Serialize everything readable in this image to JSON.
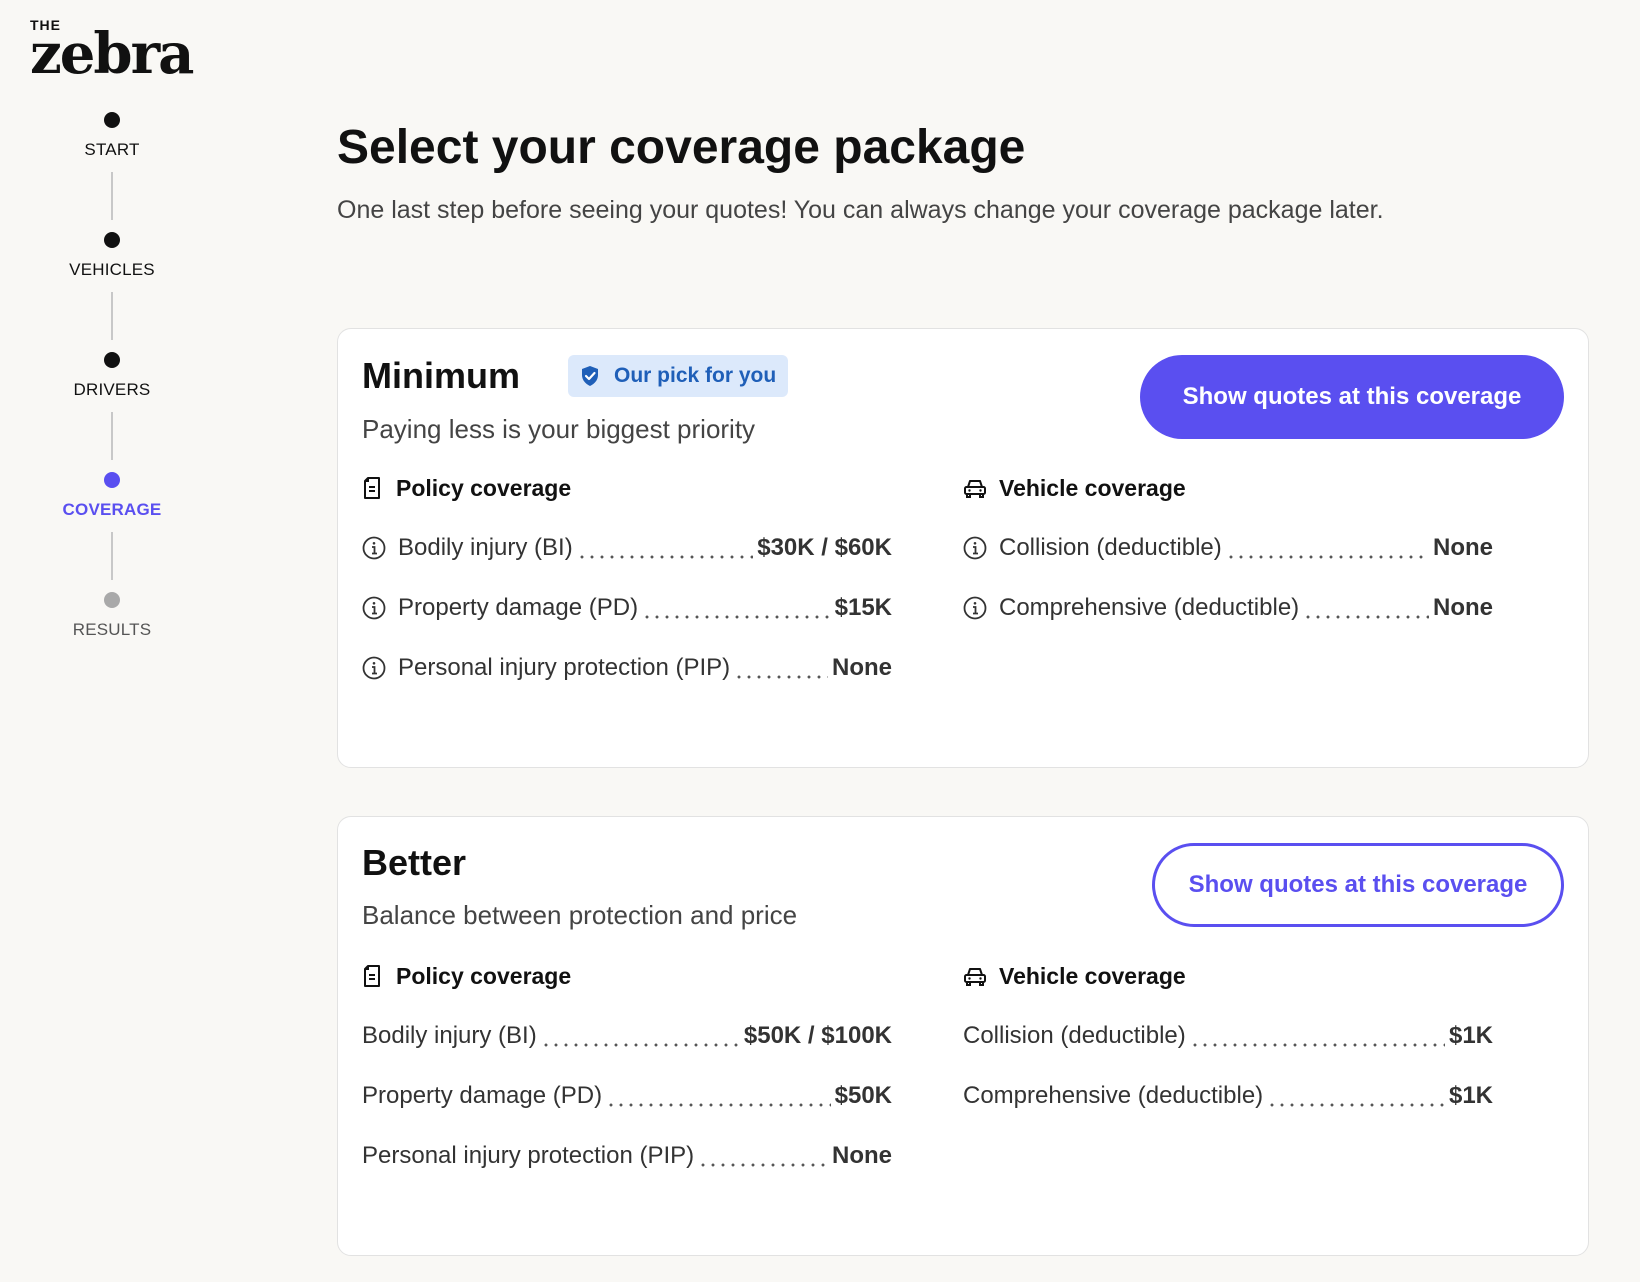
{
  "logo": {
    "small": "THE",
    "word": "zebra"
  },
  "stepper": [
    {
      "label": "START",
      "state": "done"
    },
    {
      "label": "VEHICLES",
      "state": "done"
    },
    {
      "label": "DRIVERS",
      "state": "done"
    },
    {
      "label": "COVERAGE",
      "state": "active"
    },
    {
      "label": "RESULTS",
      "state": "pending"
    }
  ],
  "header": {
    "title": "Select your coverage package",
    "subtitle": "One last step before seeing your quotes! You can always change your coverage package later."
  },
  "colors": {
    "accent": "#5a4ff0",
    "badge_bg": "#dce9fb",
    "badge_text": "#1f5fb8"
  },
  "packages": [
    {
      "title": "Minimum",
      "badge": "Our pick for you",
      "description": "Paying less is your biggest priority",
      "button": "Show quotes at this coverage",
      "policy_heading": "Policy coverage",
      "vehicle_heading": "Vehicle coverage",
      "policy": [
        {
          "label": "Bodily injury (BI)",
          "value": "$30K / $60K"
        },
        {
          "label": "Property damage (PD)",
          "value": "$15K"
        },
        {
          "label": "Personal injury protection (PIP)",
          "value": "None"
        }
      ],
      "vehicle": [
        {
          "label": "Collision (deductible)",
          "value": "None"
        },
        {
          "label": "Comprehensive (deductible)",
          "value": "None"
        }
      ]
    },
    {
      "title": "Better",
      "description": "Balance between protection and price",
      "button": "Show quotes at this coverage",
      "policy_heading": "Policy coverage",
      "vehicle_heading": "Vehicle coverage",
      "policy": [
        {
          "label": "Bodily injury (BI)",
          "value": "$50K / $100K"
        },
        {
          "label": "Property damage (PD)",
          "value": "$50K"
        },
        {
          "label": "Personal injury protection (PIP)",
          "value": "None"
        }
      ],
      "vehicle": [
        {
          "label": "Collision (deductible)",
          "value": "$1K"
        },
        {
          "label": "Comprehensive (deductible)",
          "value": "$1K"
        }
      ]
    }
  ]
}
